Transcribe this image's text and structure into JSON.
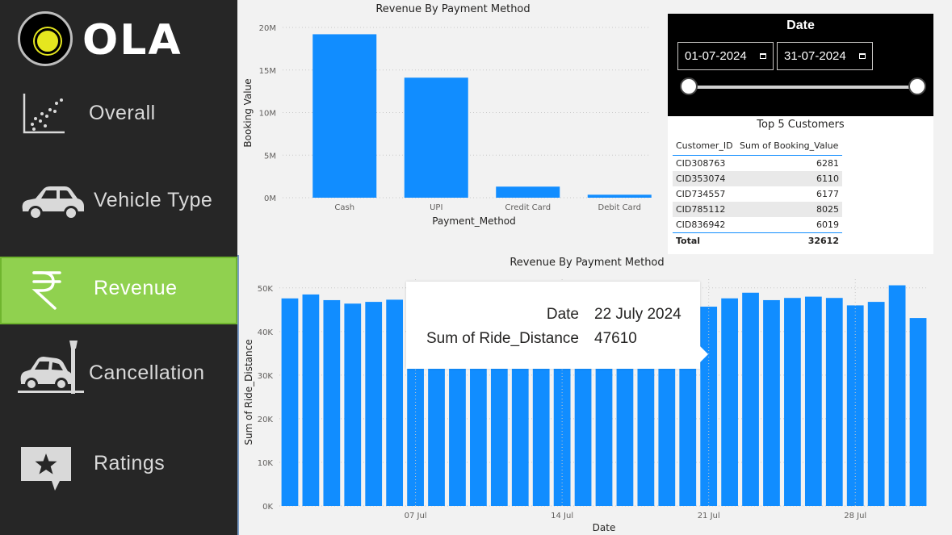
{
  "brand": {
    "logo_text": "OLA"
  },
  "sidebar": {
    "items": [
      {
        "label": "Overall",
        "icon": "scatter-chart-icon",
        "active": false
      },
      {
        "label": "Vehicle Type",
        "icon": "car-icon",
        "active": false
      },
      {
        "label": "Revenue",
        "icon": "rupee-icon",
        "active": true
      },
      {
        "label": "Cancellation",
        "icon": "car-crash-icon",
        "active": false
      },
      {
        "label": "Ratings",
        "icon": "star-speech-bubble-icon",
        "active": false
      }
    ],
    "active_color": "#90d14f",
    "background_color": "#262626"
  },
  "date_slicer": {
    "title": "Date",
    "start": "01-07-2024",
    "end": "31-07-2024"
  },
  "top_customers": {
    "title": "Top 5 Customers",
    "columns": [
      "Customer_ID",
      "Sum of Booking_Value"
    ],
    "rows": [
      {
        "id": "CID308763",
        "value": "6281"
      },
      {
        "id": "CID353074",
        "value": "6110"
      },
      {
        "id": "CID734557",
        "value": "6177"
      },
      {
        "id": "CID785112",
        "value": "8025"
      },
      {
        "id": "CID836942",
        "value": "6019"
      }
    ],
    "total_label": "Total",
    "total_value": "32612"
  },
  "tooltip": {
    "date_label": "Date",
    "date_value": "22 July 2024",
    "metric_label": "Sum of Ride_Distance",
    "metric_value": "47610"
  },
  "chart_data": [
    {
      "type": "bar",
      "title": "Revenue By Payment Method",
      "xlabel": "Payment_Method",
      "ylabel": "Booking Value",
      "categories": [
        "Cash",
        "UPI",
        "Credit Card",
        "Debit Card"
      ],
      "values": [
        19200000,
        14100000,
        1300000,
        350000
      ],
      "ylim": [
        0,
        20000000
      ],
      "yticks": [
        "0M",
        "5M",
        "10M",
        "15M",
        "20M"
      ],
      "ytick_values": [
        0,
        5000000,
        10000000,
        15000000,
        20000000
      ],
      "grid": true,
      "bar_color": "#118dff"
    },
    {
      "type": "bar",
      "title": "Revenue By Payment Method",
      "xlabel": "Date",
      "ylabel": "Sum of Ride_Distance",
      "x": [
        "2024-07-01",
        "2024-07-02",
        "2024-07-03",
        "2024-07-04",
        "2024-07-05",
        "2024-07-06",
        "2024-07-07",
        "2024-07-08",
        "2024-07-09",
        "2024-07-10",
        "2024-07-11",
        "2024-07-12",
        "2024-07-13",
        "2024-07-14",
        "2024-07-15",
        "2024-07-16",
        "2024-07-17",
        "2024-07-18",
        "2024-07-19",
        "2024-07-20",
        "2024-07-21",
        "2024-07-22",
        "2024-07-23",
        "2024-07-24",
        "2024-07-25",
        "2024-07-26",
        "2024-07-27",
        "2024-07-28",
        "2024-07-29",
        "2024-07-30",
        "2024-07-31"
      ],
      "values": [
        47600,
        48500,
        47200,
        46400,
        46800,
        47300,
        46600,
        46900,
        47000,
        47100,
        46800,
        47200,
        46900,
        47000,
        47100,
        46700,
        46800,
        47000,
        46900,
        47100,
        45700,
        47610,
        48900,
        47200,
        47700,
        48000,
        47700,
        46000,
        46800,
        50600,
        43100
      ],
      "ylim": [
        0,
        52000
      ],
      "yticks": [
        "0K",
        "10K",
        "20K",
        "30K",
        "40K",
        "50K"
      ],
      "ytick_values": [
        0,
        10000,
        20000,
        30000,
        40000,
        50000
      ],
      "xticks": [
        "07 Jul",
        "14 Jul",
        "21 Jul",
        "28 Jul"
      ],
      "xtick_dates": [
        "2024-07-07",
        "2024-07-14",
        "2024-07-21",
        "2024-07-28"
      ],
      "grid": true,
      "bar_color": "#118dff"
    }
  ]
}
